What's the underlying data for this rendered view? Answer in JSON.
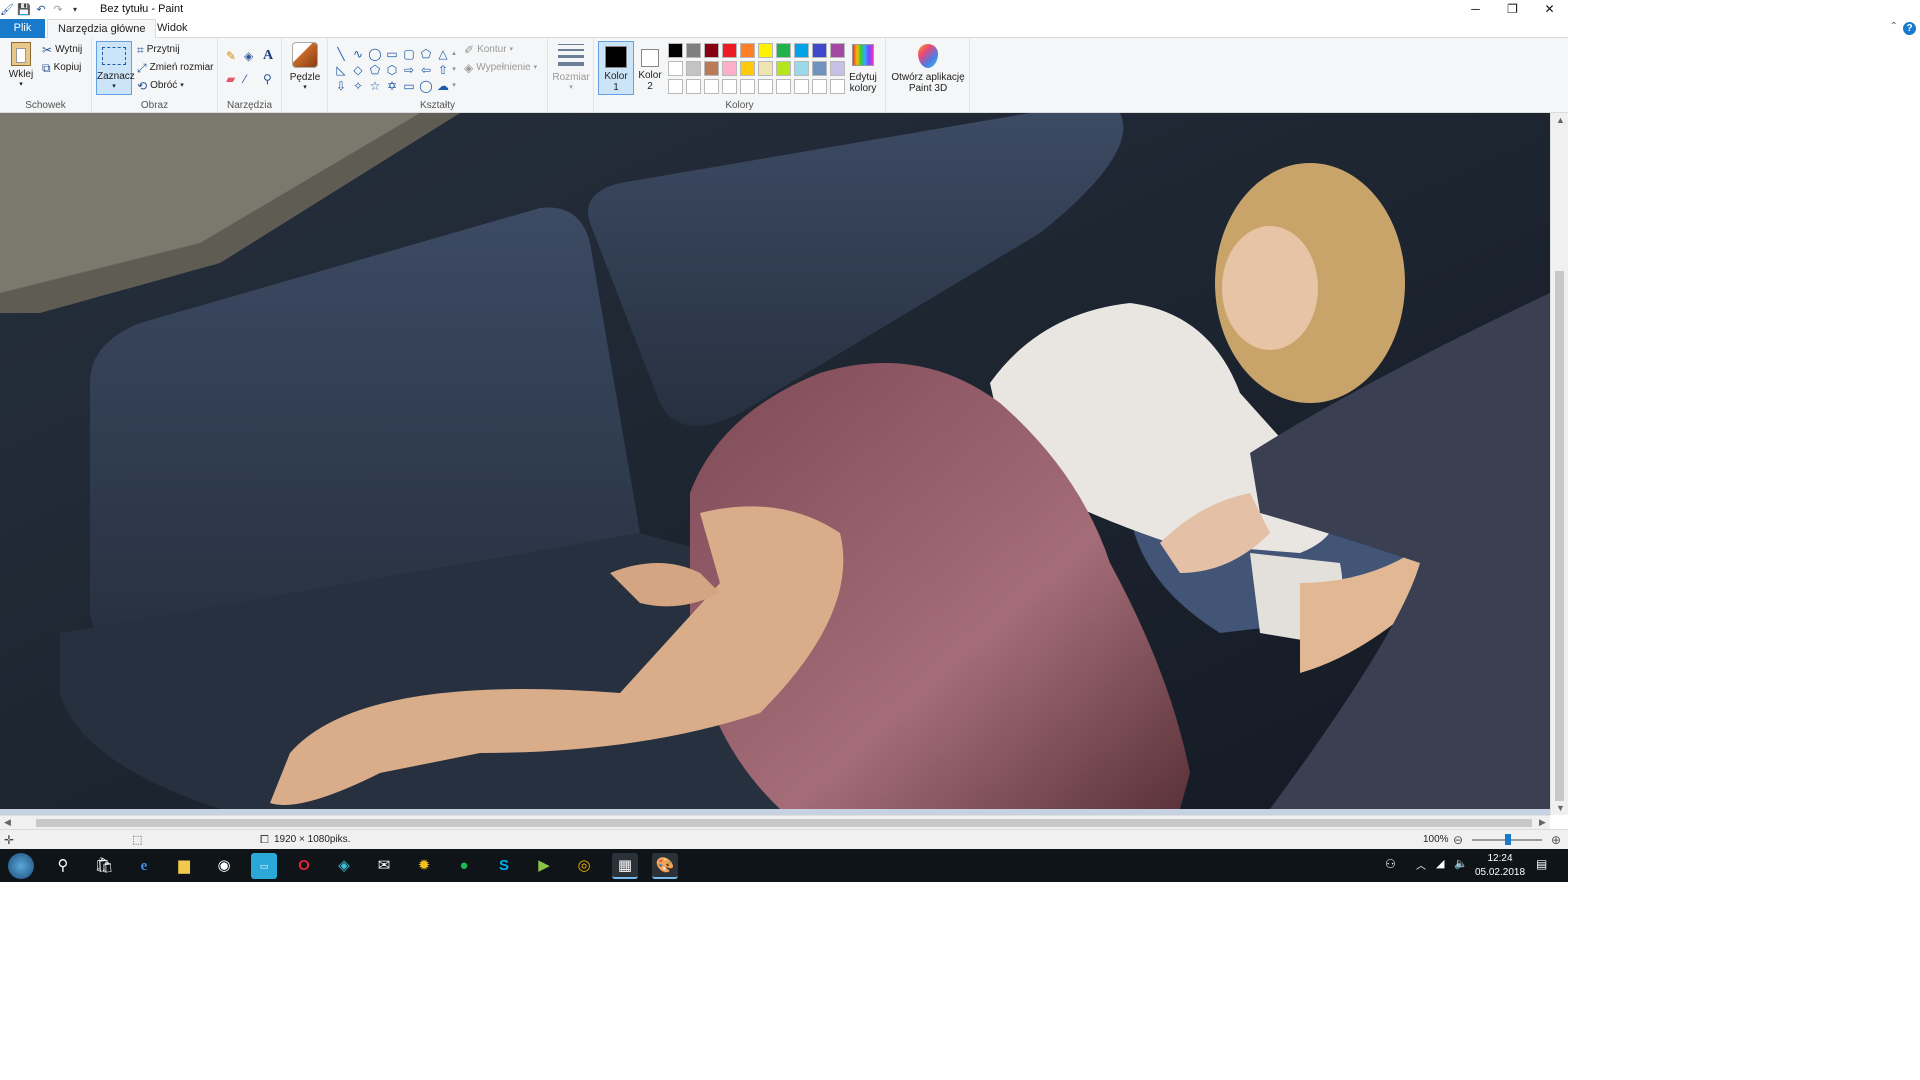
{
  "window": {
    "title": "Bez tytułu - Paint",
    "qat_icons": [
      "paint-app-icon",
      "save-icon",
      "undo-icon",
      "redo-icon",
      "customize-qat-icon"
    ]
  },
  "tabs": {
    "file": "Plik",
    "home": "Narzędzia główne",
    "view": "Widok"
  },
  "ribbon": {
    "clipboard": {
      "label": "Schowek",
      "paste": "Wklej",
      "cut": "Wytnij",
      "copy": "Kopiuj"
    },
    "image": {
      "label": "Obraz",
      "select": "Zaznacz",
      "crop": "Przytnij",
      "resize": "Zmień rozmiar",
      "rotate": "Obróć"
    },
    "tools": {
      "label": "Narzędzia"
    },
    "brushes": {
      "label": "Pędzle"
    },
    "shapes": {
      "label": "Kształty",
      "outline": "Kontur",
      "fill": "Wypełnienie"
    },
    "size": {
      "label": "Rozmiar"
    },
    "colors": {
      "label": "Kolory",
      "color1": "Kolor 1",
      "color1_line1": "Kolor",
      "color1_line2": "1",
      "color2_line1": "Kolor",
      "color2_line2": "2",
      "edit_line1": "Edytuj",
      "edit_line2": "kolory",
      "color1_value": "#000000",
      "color2_value": "#ffffff",
      "palette": [
        "#000000",
        "#7f7f7f",
        "#880015",
        "#ed1c24",
        "#ff7f27",
        "#fff200",
        "#22b14c",
        "#00a2e8",
        "#3f48cc",
        "#a349a4",
        "#ffffff",
        "#c3c3c3",
        "#b97a57",
        "#ffaec9",
        "#ffc90e",
        "#efe4b0",
        "#b5e61d",
        "#99d9ea",
        "#7092be",
        "#c8bfe7",
        "#ffffff",
        "#ffffff",
        "#ffffff",
        "#ffffff",
        "#ffffff",
        "#ffffff",
        "#ffffff",
        "#ffffff",
        "#ffffff",
        "#ffffff"
      ]
    },
    "paint3d": {
      "line1": "Otwórz aplikację",
      "line2": "Paint 3D"
    }
  },
  "status": {
    "dimensions": "1920 × 1080piks.",
    "zoom": "100%"
  },
  "taskbar": {
    "time": "12:24",
    "date": "05.02.2018",
    "apps": [
      "start-icon",
      "search-icon",
      "store-icon",
      "edge-icon",
      "explorer-icon",
      "steam-icon",
      "app-icon",
      "opera-icon",
      "app-icon",
      "mail-icon",
      "app-icon",
      "spotify-icon",
      "skype-icon",
      "app-icon",
      "chrome-icon",
      "app-icon",
      "paint-icon"
    ]
  }
}
